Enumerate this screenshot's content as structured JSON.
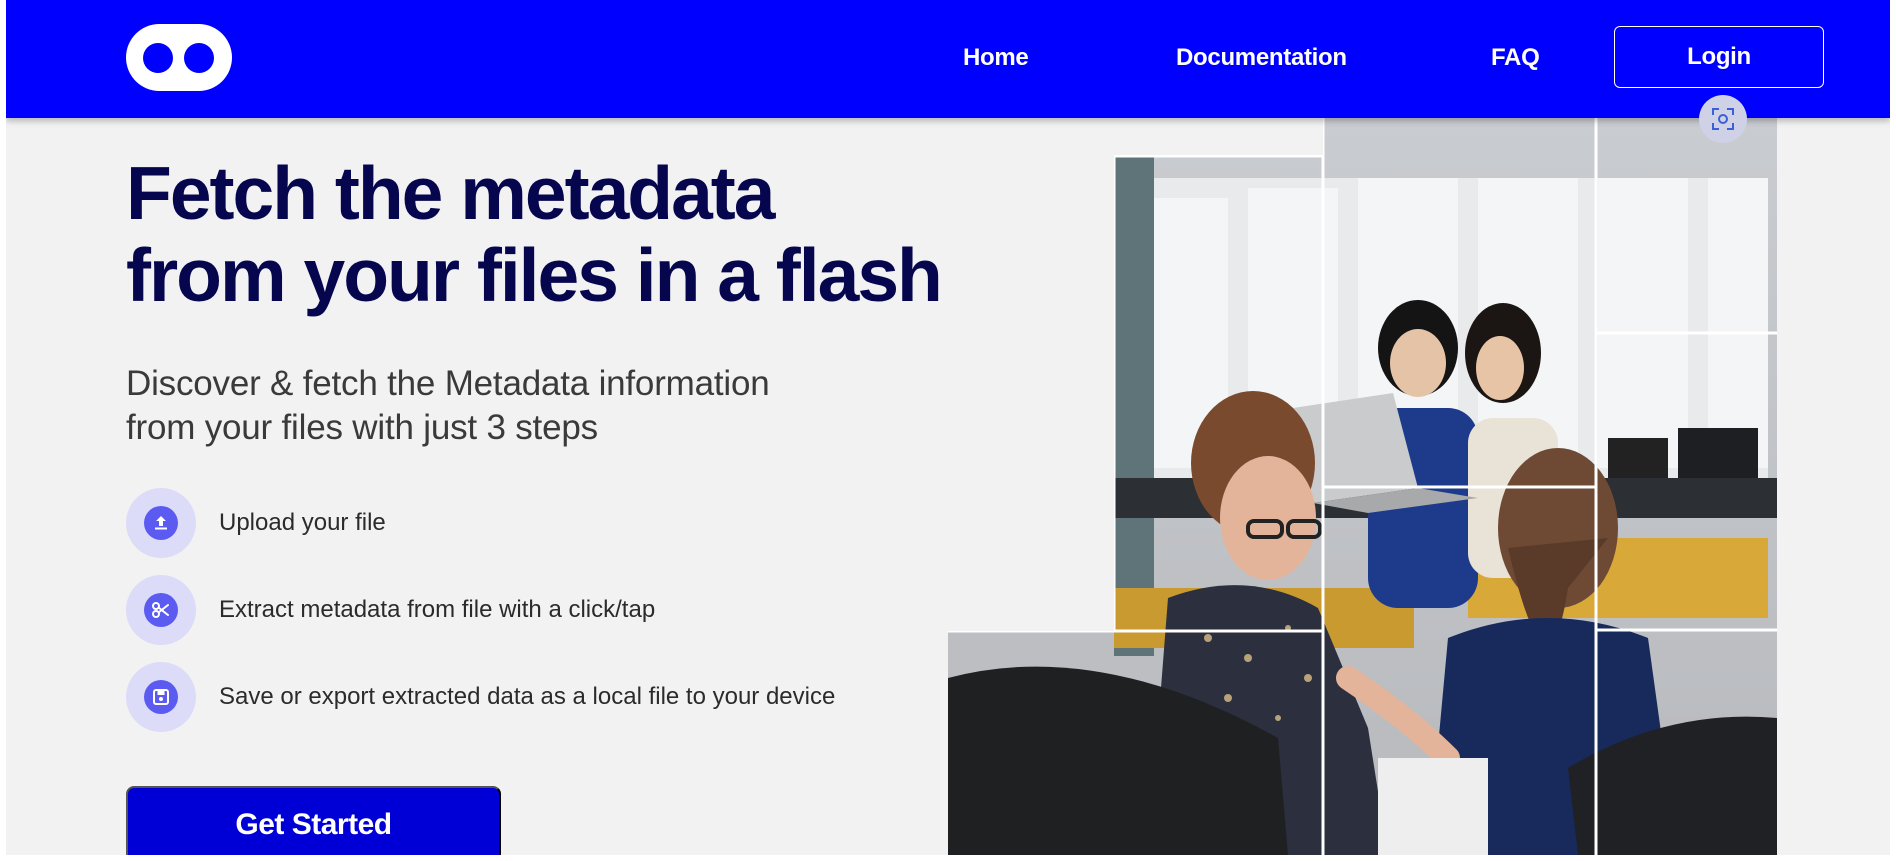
{
  "nav": {
    "links": [
      "Home",
      "Documentation",
      "FAQ"
    ],
    "login": "Login"
  },
  "hero": {
    "title_line1": "Fetch the metadata",
    "title_line2": "from your files in a flash",
    "subtitle_line1": "Discover & fetch the Metadata information",
    "subtitle_line2": "from your files with just 3 steps",
    "steps": [
      {
        "icon": "upload-icon",
        "text": "Upload your file"
      },
      {
        "icon": "scissors-icon",
        "text": "Extract metadata from file with a click/tap"
      },
      {
        "icon": "save-icon",
        "text": "Save or export extracted data as a local file to your device"
      }
    ],
    "cta": "Get Started"
  },
  "colors": {
    "nav_bg": "#0000ff",
    "title": "#06064f",
    "cta_bg": "#0000d6",
    "step_circle": "#dcdcf8",
    "step_icon": "#5b5bf2",
    "page_bg": "#f2f2f3"
  }
}
